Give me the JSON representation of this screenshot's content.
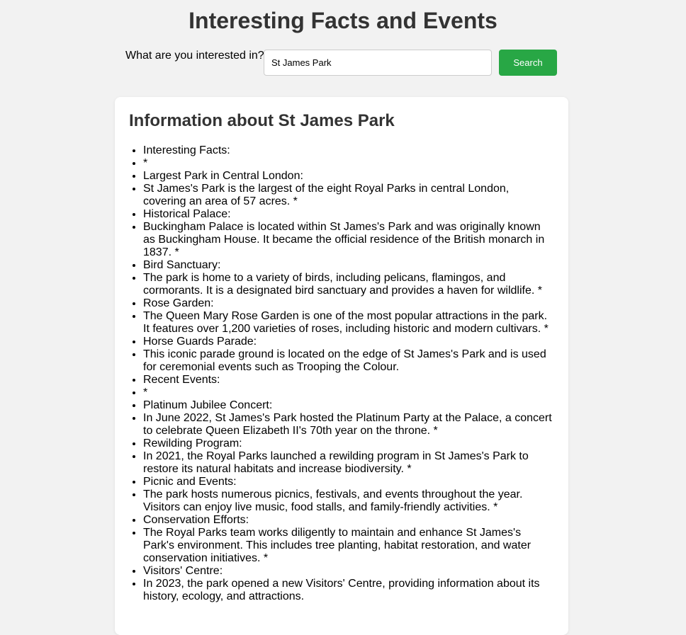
{
  "header": {
    "title": "Interesting Facts and Events"
  },
  "search": {
    "label": "What are you interested in?",
    "value": "St James Park",
    "placeholder": "",
    "button_label": "Search",
    "button_color": "#28a745"
  },
  "results": {
    "heading": "Information about St James Park",
    "items": [
      "Interesting Facts:",
      "*",
      "Largest Park in Central London:",
      "St James's Park is the largest of the eight Royal Parks in central London, covering an area of 57 acres. *",
      "Historical Palace:",
      "Buckingham Palace is located within St James's Park and was originally known as Buckingham House. It became the official residence of the British monarch in 1837. *",
      "Bird Sanctuary:",
      "The park is home to a variety of birds, including pelicans, flamingos, and cormorants. It is a designated bird sanctuary and provides a haven for wildlife. *",
      "Rose Garden:",
      "The Queen Mary Rose Garden is one of the most popular attractions in the park. It features over 1,200 varieties of roses, including historic and modern cultivars. *",
      "Horse Guards Parade:",
      "This iconic parade ground is located on the edge of St James's Park and is used for ceremonial events such as Trooping the Colour.",
      "Recent Events:",
      "*",
      "Platinum Jubilee Concert:",
      "In June 2022, St James's Park hosted the Platinum Party at the Palace, a concert to celebrate Queen Elizabeth II's 70th year on the throne. *",
      "Rewilding Program:",
      "In 2021, the Royal Parks launched a rewilding program in St James's Park to restore its natural habitats and increase biodiversity. *",
      "Picnic and Events:",
      "The park hosts numerous picnics, festivals, and events throughout the year. Visitors can enjoy live music, food stalls, and family-friendly activities. *",
      "Conservation Efforts:",
      "The Royal Parks team works diligently to maintain and enhance St James's Park's environment. This includes tree planting, habitat restoration, and water conservation initiatives. *",
      "Visitors' Centre:",
      "In 2023, the park opened a new Visitors' Centre, providing information about its history, ecology, and attractions."
    ]
  }
}
